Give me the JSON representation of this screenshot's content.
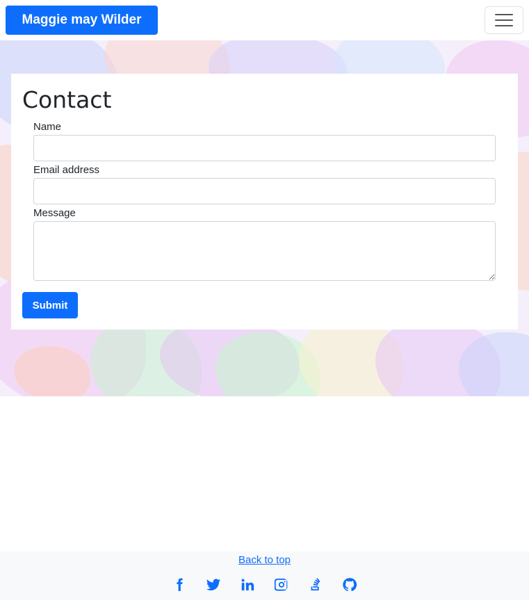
{
  "navbar": {
    "brand": "Maggie may Wilder",
    "toggle_icon": "hamburger-menu-icon"
  },
  "contact": {
    "heading": "Contact",
    "fields": [
      {
        "label": "Name",
        "value": "",
        "placeholder": ""
      },
      {
        "label": "Email address",
        "value": "",
        "placeholder": ""
      },
      {
        "label": "Message",
        "value": "",
        "placeholder": ""
      }
    ],
    "submit_label": "Submit"
  },
  "footer": {
    "back_to_top": "Back to top",
    "social_icons": [
      "facebook-icon",
      "twitter-icon",
      "linkedin-icon",
      "instagram-icon",
      "stackoverflow-icon",
      "github-icon"
    ]
  },
  "colors": {
    "primary": "#0d6efd",
    "text": "#212529",
    "footer_bg": "#f8f9fa"
  }
}
